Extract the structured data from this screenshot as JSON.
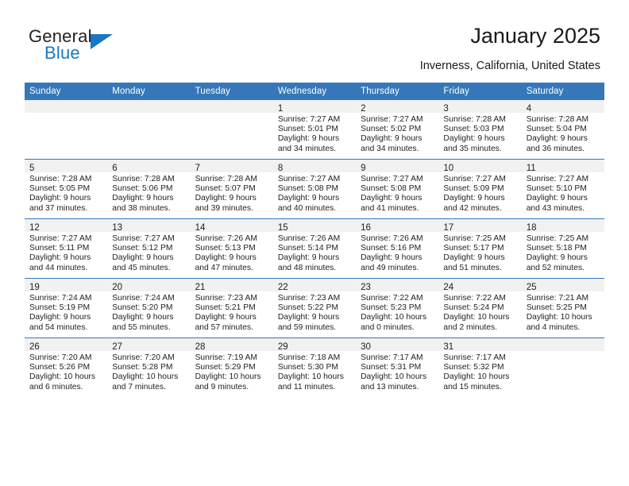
{
  "brand": {
    "name_top": "General",
    "name_bottom": "Blue",
    "triangle_icon": "triangle-icon",
    "accent_color": "#1878c4"
  },
  "header": {
    "title": "January 2025",
    "subtitle": "Inverness, California, United States"
  },
  "theme": {
    "header_blue": "#3577b8",
    "daynum_strip": "#f1f1f1",
    "text": "#222222"
  },
  "calendar": {
    "weekday_headers": [
      "Sunday",
      "Monday",
      "Tuesday",
      "Wednesday",
      "Thursday",
      "Friday",
      "Saturday"
    ],
    "labels": {
      "sunrise": "Sunrise:",
      "sunset": "Sunset:",
      "daylight": "Daylight:"
    },
    "weeks": [
      [
        {
          "day": "",
          "empty": true
        },
        {
          "day": "",
          "empty": true
        },
        {
          "day": "",
          "empty": true
        },
        {
          "day": "1",
          "sunrise": "Sunrise: 7:27 AM",
          "sunset": "Sunset: 5:01 PM",
          "daylight1": "Daylight: 9 hours",
          "daylight2": "and 34 minutes."
        },
        {
          "day": "2",
          "sunrise": "Sunrise: 7:27 AM",
          "sunset": "Sunset: 5:02 PM",
          "daylight1": "Daylight: 9 hours",
          "daylight2": "and 34 minutes."
        },
        {
          "day": "3",
          "sunrise": "Sunrise: 7:28 AM",
          "sunset": "Sunset: 5:03 PM",
          "daylight1": "Daylight: 9 hours",
          "daylight2": "and 35 minutes."
        },
        {
          "day": "4",
          "sunrise": "Sunrise: 7:28 AM",
          "sunset": "Sunset: 5:04 PM",
          "daylight1": "Daylight: 9 hours",
          "daylight2": "and 36 minutes."
        }
      ],
      [
        {
          "day": "5",
          "sunrise": "Sunrise: 7:28 AM",
          "sunset": "Sunset: 5:05 PM",
          "daylight1": "Daylight: 9 hours",
          "daylight2": "and 37 minutes."
        },
        {
          "day": "6",
          "sunrise": "Sunrise: 7:28 AM",
          "sunset": "Sunset: 5:06 PM",
          "daylight1": "Daylight: 9 hours",
          "daylight2": "and 38 minutes."
        },
        {
          "day": "7",
          "sunrise": "Sunrise: 7:28 AM",
          "sunset": "Sunset: 5:07 PM",
          "daylight1": "Daylight: 9 hours",
          "daylight2": "and 39 minutes."
        },
        {
          "day": "8",
          "sunrise": "Sunrise: 7:27 AM",
          "sunset": "Sunset: 5:08 PM",
          "daylight1": "Daylight: 9 hours",
          "daylight2": "and 40 minutes."
        },
        {
          "day": "9",
          "sunrise": "Sunrise: 7:27 AM",
          "sunset": "Sunset: 5:08 PM",
          "daylight1": "Daylight: 9 hours",
          "daylight2": "and 41 minutes."
        },
        {
          "day": "10",
          "sunrise": "Sunrise: 7:27 AM",
          "sunset": "Sunset: 5:09 PM",
          "daylight1": "Daylight: 9 hours",
          "daylight2": "and 42 minutes."
        },
        {
          "day": "11",
          "sunrise": "Sunrise: 7:27 AM",
          "sunset": "Sunset: 5:10 PM",
          "daylight1": "Daylight: 9 hours",
          "daylight2": "and 43 minutes."
        }
      ],
      [
        {
          "day": "12",
          "sunrise": "Sunrise: 7:27 AM",
          "sunset": "Sunset: 5:11 PM",
          "daylight1": "Daylight: 9 hours",
          "daylight2": "and 44 minutes."
        },
        {
          "day": "13",
          "sunrise": "Sunrise: 7:27 AM",
          "sunset": "Sunset: 5:12 PM",
          "daylight1": "Daylight: 9 hours",
          "daylight2": "and 45 minutes."
        },
        {
          "day": "14",
          "sunrise": "Sunrise: 7:26 AM",
          "sunset": "Sunset: 5:13 PM",
          "daylight1": "Daylight: 9 hours",
          "daylight2": "and 47 minutes."
        },
        {
          "day": "15",
          "sunrise": "Sunrise: 7:26 AM",
          "sunset": "Sunset: 5:14 PM",
          "daylight1": "Daylight: 9 hours",
          "daylight2": "and 48 minutes."
        },
        {
          "day": "16",
          "sunrise": "Sunrise: 7:26 AM",
          "sunset": "Sunset: 5:16 PM",
          "daylight1": "Daylight: 9 hours",
          "daylight2": "and 49 minutes."
        },
        {
          "day": "17",
          "sunrise": "Sunrise: 7:25 AM",
          "sunset": "Sunset: 5:17 PM",
          "daylight1": "Daylight: 9 hours",
          "daylight2": "and 51 minutes."
        },
        {
          "day": "18",
          "sunrise": "Sunrise: 7:25 AM",
          "sunset": "Sunset: 5:18 PM",
          "daylight1": "Daylight: 9 hours",
          "daylight2": "and 52 minutes."
        }
      ],
      [
        {
          "day": "19",
          "sunrise": "Sunrise: 7:24 AM",
          "sunset": "Sunset: 5:19 PM",
          "daylight1": "Daylight: 9 hours",
          "daylight2": "and 54 minutes."
        },
        {
          "day": "20",
          "sunrise": "Sunrise: 7:24 AM",
          "sunset": "Sunset: 5:20 PM",
          "daylight1": "Daylight: 9 hours",
          "daylight2": "and 55 minutes."
        },
        {
          "day": "21",
          "sunrise": "Sunrise: 7:23 AM",
          "sunset": "Sunset: 5:21 PM",
          "daylight1": "Daylight: 9 hours",
          "daylight2": "and 57 minutes."
        },
        {
          "day": "22",
          "sunrise": "Sunrise: 7:23 AM",
          "sunset": "Sunset: 5:22 PM",
          "daylight1": "Daylight: 9 hours",
          "daylight2": "and 59 minutes."
        },
        {
          "day": "23",
          "sunrise": "Sunrise: 7:22 AM",
          "sunset": "Sunset: 5:23 PM",
          "daylight1": "Daylight: 10 hours",
          "daylight2": "and 0 minutes."
        },
        {
          "day": "24",
          "sunrise": "Sunrise: 7:22 AM",
          "sunset": "Sunset: 5:24 PM",
          "daylight1": "Daylight: 10 hours",
          "daylight2": "and 2 minutes."
        },
        {
          "day": "25",
          "sunrise": "Sunrise: 7:21 AM",
          "sunset": "Sunset: 5:25 PM",
          "daylight1": "Daylight: 10 hours",
          "daylight2": "and 4 minutes."
        }
      ],
      [
        {
          "day": "26",
          "sunrise": "Sunrise: 7:20 AM",
          "sunset": "Sunset: 5:26 PM",
          "daylight1": "Daylight: 10 hours",
          "daylight2": "and 6 minutes."
        },
        {
          "day": "27",
          "sunrise": "Sunrise: 7:20 AM",
          "sunset": "Sunset: 5:28 PM",
          "daylight1": "Daylight: 10 hours",
          "daylight2": "and 7 minutes."
        },
        {
          "day": "28",
          "sunrise": "Sunrise: 7:19 AM",
          "sunset": "Sunset: 5:29 PM",
          "daylight1": "Daylight: 10 hours",
          "daylight2": "and 9 minutes."
        },
        {
          "day": "29",
          "sunrise": "Sunrise: 7:18 AM",
          "sunset": "Sunset: 5:30 PM",
          "daylight1": "Daylight: 10 hours",
          "daylight2": "and 11 minutes."
        },
        {
          "day": "30",
          "sunrise": "Sunrise: 7:17 AM",
          "sunset": "Sunset: 5:31 PM",
          "daylight1": "Daylight: 10 hours",
          "daylight2": "and 13 minutes."
        },
        {
          "day": "31",
          "sunrise": "Sunrise: 7:17 AM",
          "sunset": "Sunset: 5:32 PM",
          "daylight1": "Daylight: 10 hours",
          "daylight2": "and 15 minutes."
        },
        {
          "day": "",
          "empty": true
        }
      ]
    ]
  }
}
